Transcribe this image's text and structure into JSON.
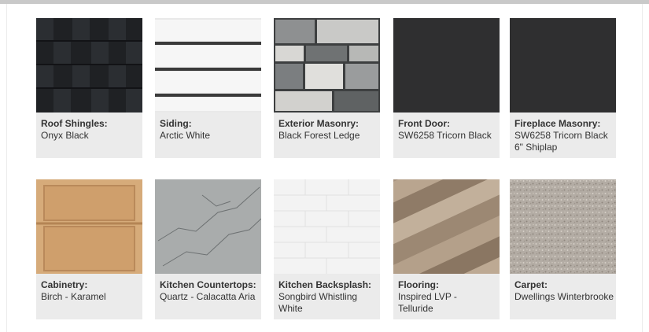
{
  "swatches": [
    {
      "title": "Roof Shingles:",
      "value": "Onyx Black",
      "color": "#1f2124",
      "icon": "shingle-texture"
    },
    {
      "title": "Siding:",
      "value": "Arctic White",
      "color": "#e7e7e7",
      "icon": "lap-siding-texture"
    },
    {
      "title": "Exterior Masonry:",
      "value": "Black Forest Ledge",
      "color": "#8b8d8c",
      "icon": "ledge-stone-texture"
    },
    {
      "title": "Front Door:",
      "value": "SW6258 Tricorn Black",
      "color": "#2f2f30",
      "icon": "solid-color"
    },
    {
      "title": "Fireplace Masonry:",
      "value": "SW6258 Tricorn Black\n6\" Shiplap",
      "color": "#2f2f30",
      "icon": "solid-color"
    },
    {
      "title": "Cabinetry:",
      "value": "Birch - Karamel",
      "color": "#d6ab7a",
      "icon": "shaker-door-texture"
    },
    {
      "title": "Kitchen Countertops:",
      "value": "Quartz - Calacatta Aria",
      "color": "#a9acac",
      "icon": "marble-texture"
    },
    {
      "title": "Kitchen Backsplash:",
      "value": "Songbird Whistling\nWhite",
      "color": "#f3f3f3",
      "icon": "subway-tile-texture"
    },
    {
      "title": "Flooring:",
      "value": "Inspired LVP -\nTelluride",
      "color": "#a6927e",
      "icon": "wood-plank-texture"
    },
    {
      "title": "Carpet:",
      "value": "Dwellings Winterbrooke",
      "color": "#b3aca4",
      "icon": "carpet-texture"
    }
  ]
}
